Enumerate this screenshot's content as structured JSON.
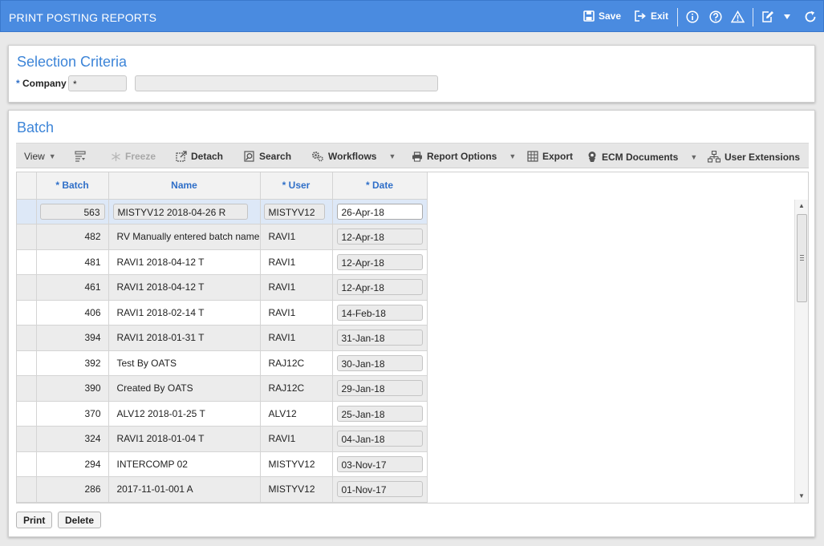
{
  "header": {
    "title": "PRINT POSTING REPORTS",
    "save_label": "Save",
    "exit_label": "Exit"
  },
  "selection": {
    "title": "Selection Criteria",
    "company_req": "*",
    "company_label": "Company",
    "company_value": "*",
    "company_name": ""
  },
  "batch": {
    "title": "Batch",
    "toolbar": {
      "view": "View",
      "freeze": "Freeze",
      "detach": "Detach",
      "search": "Search",
      "workflows": "Workflows",
      "report_options": "Report Options",
      "export": "Export",
      "ecm_documents": "ECM Documents",
      "user_extensions": "User Extensions"
    },
    "columns": {
      "batch": "* Batch",
      "name": "* Name",
      "user": "* User",
      "date": "* Date"
    },
    "columns_display": {
      "batch": "* Batch",
      "name": "Name",
      "user": "* User",
      "date": "* Date"
    },
    "rows": [
      {
        "batch": "563",
        "name": "MISTYV12 2018-04-26 R",
        "user": "MISTYV12",
        "date": "26-Apr-18"
      },
      {
        "batch": "482",
        "name": "RV Manually entered batch name",
        "user": "RAVI1",
        "date": "12-Apr-18"
      },
      {
        "batch": "481",
        "name": "RAVI1 2018-04-12 T",
        "user": "RAVI1",
        "date": "12-Apr-18"
      },
      {
        "batch": "461",
        "name": "RAVI1 2018-04-12 T",
        "user": "RAVI1",
        "date": "12-Apr-18"
      },
      {
        "batch": "406",
        "name": "RAVI1 2018-02-14 T",
        "user": "RAVI1",
        "date": "14-Feb-18"
      },
      {
        "batch": "394",
        "name": "RAVI1 2018-01-31 T",
        "user": "RAVI1",
        "date": "31-Jan-18"
      },
      {
        "batch": "392",
        "name": "Test By OATS",
        "user": "RAJ12C",
        "date": "30-Jan-18"
      },
      {
        "batch": "390",
        "name": "Created By OATS",
        "user": "RAJ12C",
        "date": "29-Jan-18"
      },
      {
        "batch": "370",
        "name": "ALV12 2018-01-25 T",
        "user": "ALV12",
        "date": "25-Jan-18"
      },
      {
        "batch": "324",
        "name": "RAVI1 2018-01-04 T",
        "user": "RAVI1",
        "date": "04-Jan-18"
      },
      {
        "batch": "294",
        "name": "INTERCOMP 02",
        "user": "MISTYV12",
        "date": "03-Nov-17"
      },
      {
        "batch": "286",
        "name": "2017-11-01-001 A",
        "user": "MISTYV12",
        "date": "01-Nov-17"
      }
    ],
    "print_label": "Print",
    "delete_label": "Delete"
  },
  "colors": {
    "header_bg": "#4a8be0",
    "title_blue": "#3d85d8",
    "column_header": "#2f6fc8"
  }
}
